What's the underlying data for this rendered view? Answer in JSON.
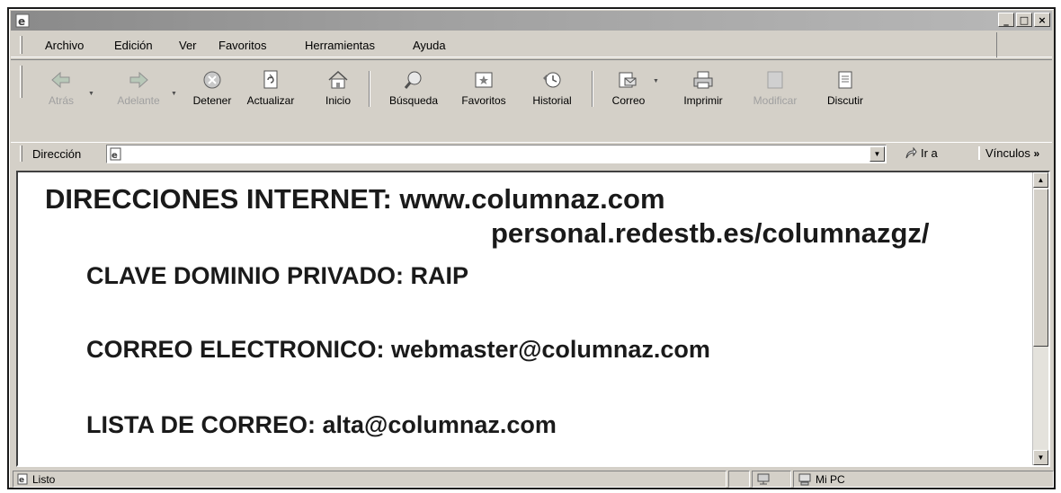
{
  "window": {
    "title": "",
    "controls": {
      "minimize": "_",
      "maximize": "□",
      "close": "×"
    }
  },
  "menubar": {
    "items": [
      {
        "label": "Archivo"
      },
      {
        "label": "Edición"
      },
      {
        "label": "Ver"
      },
      {
        "label": "Favoritos"
      },
      {
        "label": "Herramientas"
      },
      {
        "label": "Ayuda"
      }
    ]
  },
  "toolbar": {
    "buttons": [
      {
        "label": "Atrás",
        "icon": "back-arrow-icon",
        "enabled": false
      },
      {
        "label": "Adelante",
        "icon": "forward-arrow-icon",
        "enabled": false
      },
      {
        "label": "Detener",
        "icon": "stop-icon",
        "enabled": true
      },
      {
        "label": "Actualizar",
        "icon": "refresh-icon",
        "enabled": true
      },
      {
        "label": "Inicio",
        "icon": "home-icon",
        "enabled": true
      },
      {
        "label": "Búsqueda",
        "icon": "search-icon",
        "enabled": true
      },
      {
        "label": "Favoritos",
        "icon": "favorites-icon",
        "enabled": true
      },
      {
        "label": "Historial",
        "icon": "history-icon",
        "enabled": true
      },
      {
        "label": "Correo",
        "icon": "mail-icon",
        "enabled": true
      },
      {
        "label": "Imprimir",
        "icon": "print-icon",
        "enabled": true
      },
      {
        "label": "Modificar",
        "icon": "edit-icon",
        "enabled": false
      },
      {
        "label": "Discutir",
        "icon": "discuss-icon",
        "enabled": true
      }
    ]
  },
  "addressbar": {
    "label": "Dirección",
    "value": "",
    "go_label": "Ir a",
    "links_label": "Vínculos"
  },
  "content": {
    "line1": "DIRECCIONES INTERNET: www.columnaz.com",
    "line2": "personal.redestb.es/columnazgz/",
    "line3": "CLAVE DOMINIO PRIVADO: RAIP",
    "line4": "CORREO ELECTRONICO: webmaster@columnaz.com",
    "line5": "LISTA DE CORREO: alta@columnaz.com"
  },
  "statusbar": {
    "status": "Listo",
    "zone": "Mi PC"
  }
}
